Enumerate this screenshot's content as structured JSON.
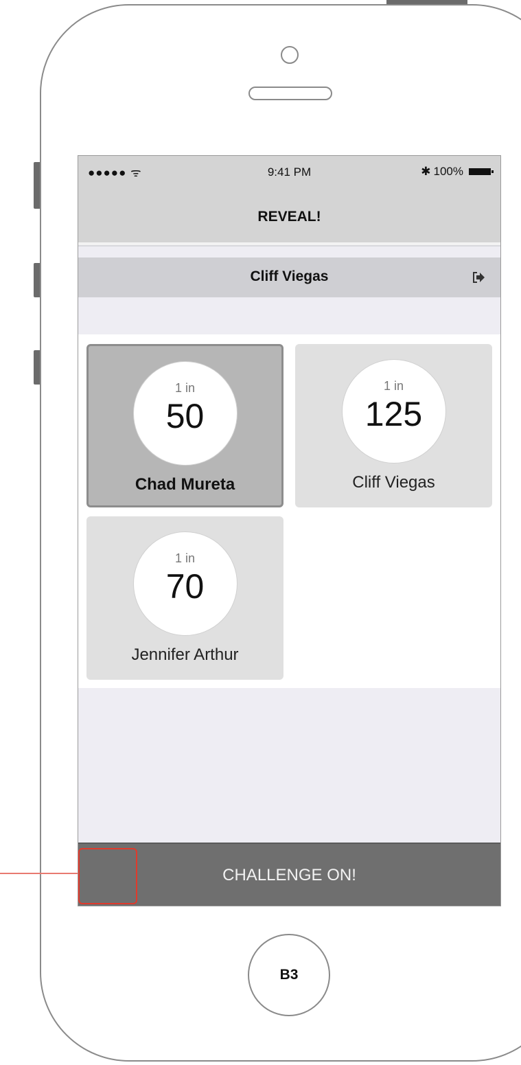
{
  "status_bar": {
    "signal": "●●●●● ᯤ",
    "time": "9:41 PM",
    "battery": "100%"
  },
  "nav": {
    "title": "REVEAL!"
  },
  "user_bar": {
    "name": "Cliff Viegas"
  },
  "cards": [
    {
      "prefix": "1 in",
      "odds": "50",
      "name": "Chad Mureta",
      "selected": true
    },
    {
      "prefix": "1 in",
      "odds": "125",
      "name": "Cliff Viegas",
      "selected": false
    },
    {
      "prefix": "1 in",
      "odds": "70",
      "name": "Jennifer Arthur",
      "selected": false
    }
  ],
  "cta": {
    "label": "CHALLENGE ON!"
  },
  "home_button": {
    "label": "B3"
  }
}
